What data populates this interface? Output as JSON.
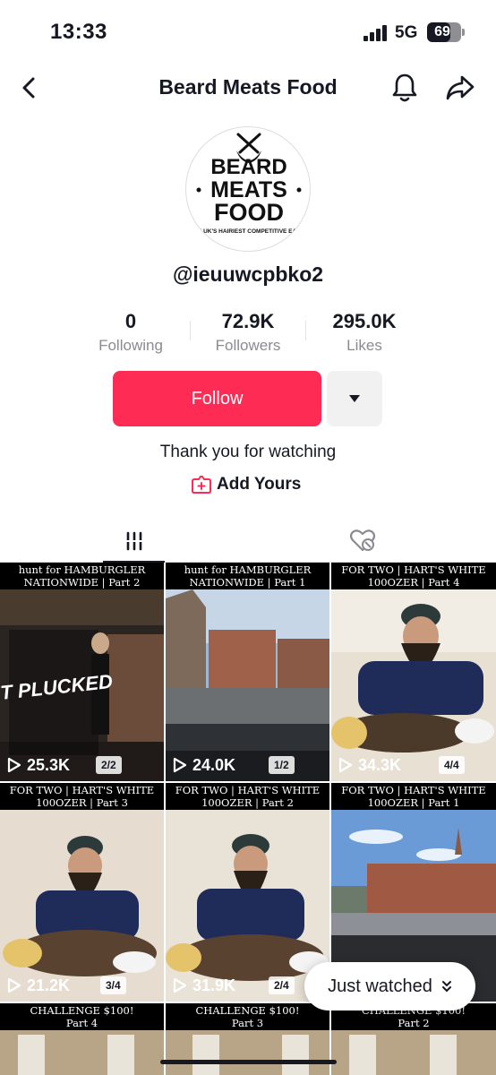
{
  "status_bar": {
    "time": "13:33",
    "network": "5G",
    "battery": "69",
    "battery_level": 0.69
  },
  "header": {
    "title": "Beard Meats Food"
  },
  "profile": {
    "username": "@ieuuwcpbko2",
    "logo_text": {
      "line1": "BEARD",
      "line2": "MEATS",
      "line3": "FOOD",
      "tagline": "THE UK'S HAIRIEST COMPETITIVE EATER"
    },
    "bio": "Thank you for watching",
    "add_yours_label": "Add Yours"
  },
  "stats": [
    {
      "value": "0",
      "label": "Following"
    },
    {
      "value": "72.9K",
      "label": "Followers"
    },
    {
      "value": "295.0K",
      "label": "Likes"
    }
  ],
  "actions": {
    "follow_label": "Follow"
  },
  "colors": {
    "accent": "#fe2c55",
    "text": "#161823",
    "muted": "#8a8b91"
  },
  "videos": [
    {
      "header_line1": "hunt for HAMBURGLER",
      "header_line2": "NATIONWIDE | Part 2",
      "views": "25.3K",
      "badge": "2/2",
      "scene": "restaurant",
      "caption_art": "GET PLUCKED"
    },
    {
      "header_line1": "hunt for HAMBURGLER",
      "header_line2": "NATIONWIDE | Part 1",
      "views": "24.0K",
      "badge": "1/2",
      "scene": "street"
    },
    {
      "header_line1": "FOR TWO | HART'S WHITE",
      "header_line2": "100OZER | Part 4",
      "views": "34.3K",
      "badge": "4/4",
      "scene": "eating"
    },
    {
      "header_line1": "FOR TWO | HART'S WHITE",
      "header_line2": "100OZER | Part 3",
      "views": "21.2K",
      "badge": "3/4",
      "scene": "eating"
    },
    {
      "header_line1": "FOR TWO | HART'S WHITE",
      "header_line2": "100OZER | Part 2",
      "views": "31.9K",
      "badge": "2/4",
      "scene": "eating"
    },
    {
      "header_line1": "FOR TWO | HART'S WHITE",
      "header_line2": "100OZER | Part 1",
      "views": "",
      "badge": "",
      "scene": "street"
    },
    {
      "header_line1": "CHALLENGE $100!",
      "header_line2": "Part 4",
      "views": "",
      "badge": "",
      "scene": "interior"
    },
    {
      "header_line1": "CHALLENGE $100!",
      "header_line2": "Part 3",
      "views": "",
      "badge": "",
      "scene": "interior"
    },
    {
      "header_line1": "CHALLENGE $100!",
      "header_line2": "Part 2",
      "views": "",
      "badge": "",
      "scene": "interior"
    }
  ],
  "just_watched_label": "Just watched"
}
